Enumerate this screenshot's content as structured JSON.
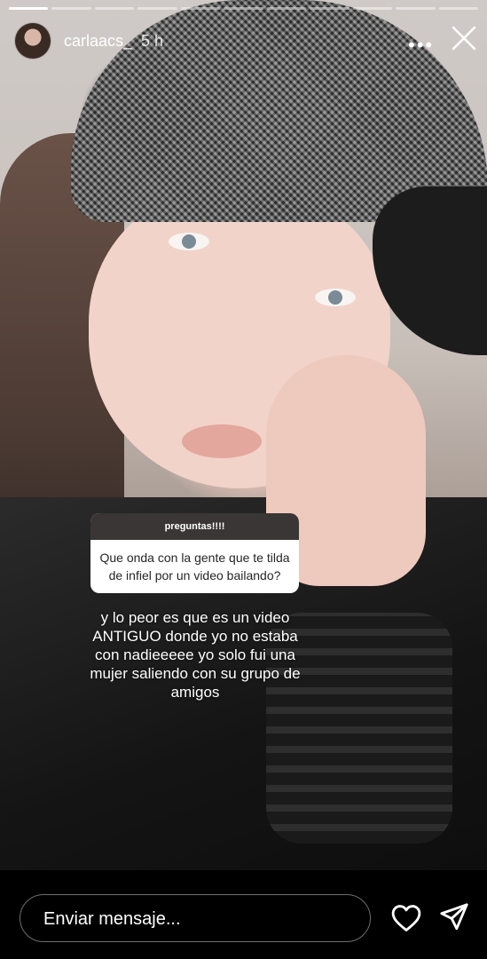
{
  "story": {
    "progress_segments": 11,
    "progress_done": 0,
    "username": "carlaacs_",
    "time_ago": "5 h",
    "more_icon": "more-horizontal-icon",
    "close_icon": "close-icon"
  },
  "question_sticker": {
    "header": "preguntas!!!!",
    "question": "Que onda con la gente que te tilda de infiel por un video bailando?"
  },
  "caption": "y lo peor es que es un video ANTIGUO donde yo no estaba con nadieeeee yo solo fui una mujer saliendo con su grupo de amigos",
  "reply_bar": {
    "placeholder": "Enviar mensaje...",
    "like_icon": "heart-icon",
    "send_icon": "send-icon"
  },
  "colors": {
    "sticker_header_bg": "#3a3636",
    "background": "#000000"
  }
}
